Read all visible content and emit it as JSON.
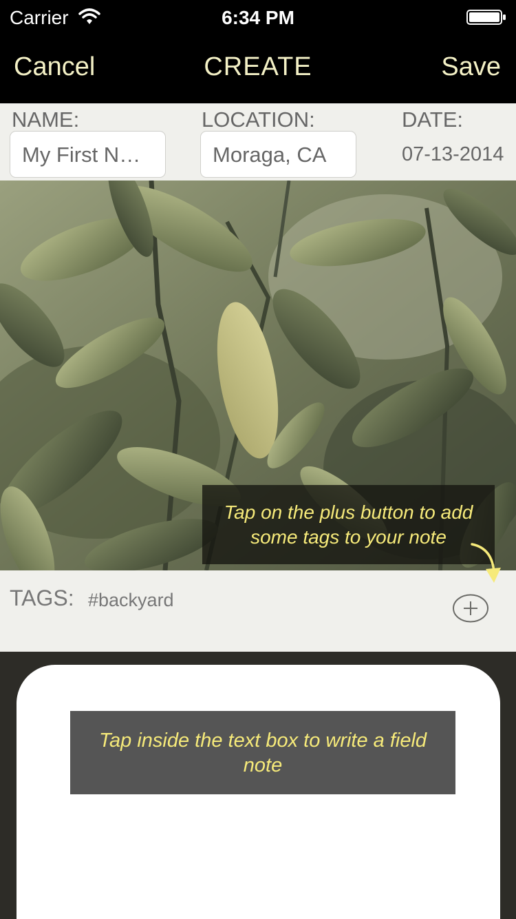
{
  "status": {
    "carrier": "Carrier",
    "time": "6:34 PM"
  },
  "nav": {
    "cancel": "Cancel",
    "title": "CREATE",
    "save": "Save"
  },
  "form": {
    "name_label": "NAME:",
    "name_value": "My First N…",
    "location_label": "LOCATION:",
    "location_value": "Moraga, CA",
    "date_label": "DATE:",
    "date_value": "07-13-2014"
  },
  "tips": {
    "tags": "Tap on the plus button to add some tags to your note",
    "note": "Tap inside the text box to write a field note"
  },
  "tags": {
    "label": "TAGS:",
    "value": "#backyard"
  },
  "icons": {
    "wifi": "wifi-icon",
    "battery": "battery-icon",
    "add": "plus-circle-icon",
    "arrow": "curved-arrow-icon"
  },
  "colors": {
    "accent": "#f4f1c6",
    "tip_text": "#f6ea7a"
  }
}
